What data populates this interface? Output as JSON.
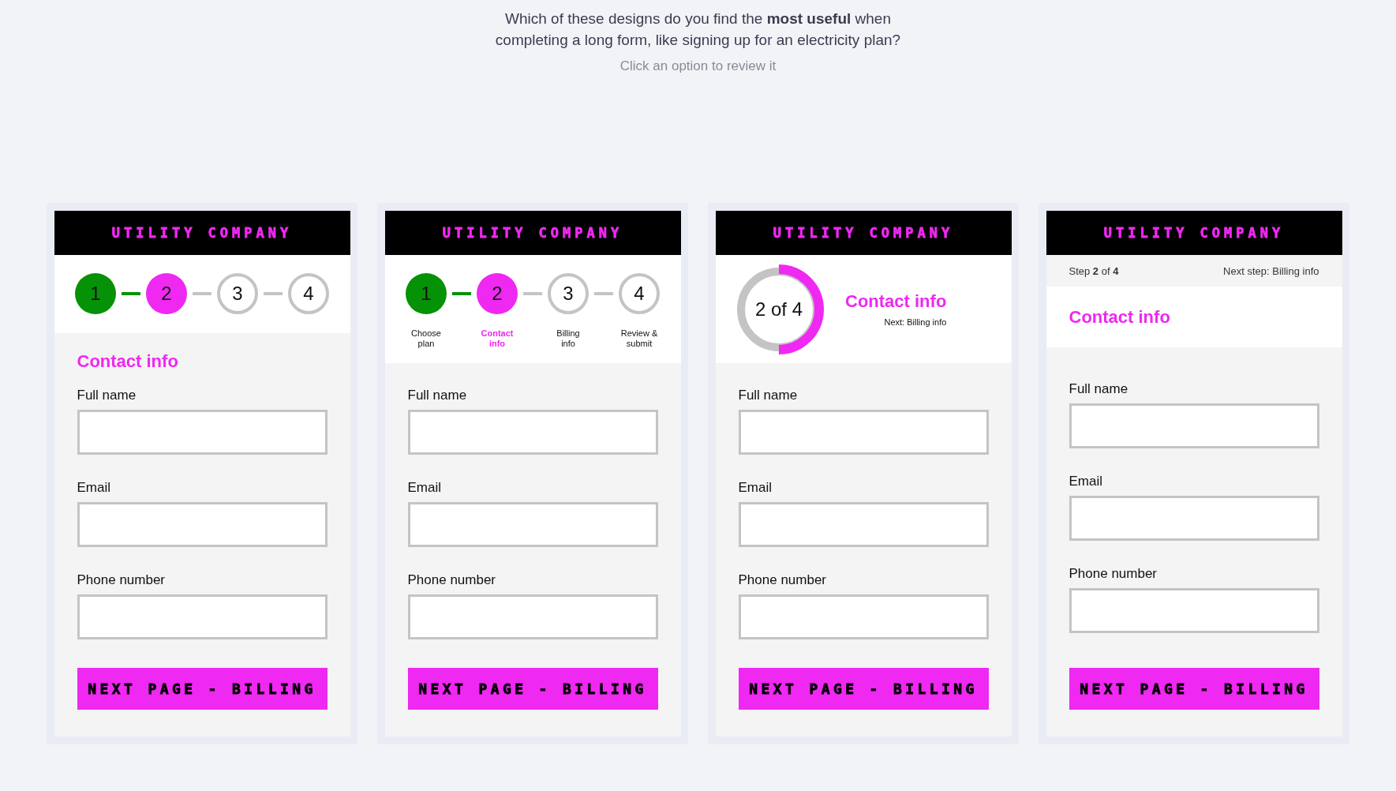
{
  "question": {
    "text": "Which of these designs do you find the **most useful** when completing a long form, like signing up for an electricity plan?",
    "hint": "Click an option to review it"
  },
  "options": [
    {
      "kind": "stepper",
      "brand": "UTILITY COMPANY",
      "steps": [
        {
          "number": "1",
          "completed": true,
          "selected": false
        },
        {
          "number": "2",
          "completed": false,
          "selected": true
        },
        {
          "number": "3",
          "completed": false,
          "selected": false
        },
        {
          "number": "4",
          "completed": false,
          "selected": false
        }
      ],
      "section_title": "Contact info",
      "fields": [
        {
          "label": "Full name"
        },
        {
          "label": "Email"
        },
        {
          "label": "Phone number"
        }
      ],
      "button": "NEXT PAGE - BILLING"
    },
    {
      "kind": "labeled_stepper",
      "brand": "UTILITY COMPANY",
      "steps": [
        {
          "number": "1",
          "label": "Choose plan",
          "completed": true,
          "selected": false
        },
        {
          "number": "2",
          "label": "Contact info",
          "completed": false,
          "selected": true
        },
        {
          "number": "3",
          "label": "Billing info",
          "completed": false,
          "selected": false
        },
        {
          "number": "4",
          "label": "Review & submit",
          "completed": false,
          "selected": false
        }
      ],
      "fields": [
        {
          "label": "Full name"
        },
        {
          "label": "Email"
        },
        {
          "label": "Phone number"
        }
      ],
      "button": "NEXT PAGE - BILLING"
    },
    {
      "kind": "ring",
      "brand": "UTILITY COMPANY",
      "progress": {
        "text": "2 of 4",
        "level": 0.5
      },
      "section_title": "Contact info",
      "next_step": "Next: Billing info",
      "fields": [
        {
          "label": "Full name"
        },
        {
          "label": "Email"
        },
        {
          "label": "Phone number"
        }
      ],
      "button": "NEXT PAGE - BILLING"
    },
    {
      "kind": "step_bar",
      "brand": "UTILITY COMPANY",
      "step_text": "Step **2** of **4**",
      "next_step": "Next step: Billing info",
      "section_title": "Contact info",
      "fields": [
        {
          "label": "Full name"
        },
        {
          "label": "Email"
        },
        {
          "label": "Phone number"
        }
      ],
      "button": "NEXT PAGE - BILLING"
    }
  ]
}
